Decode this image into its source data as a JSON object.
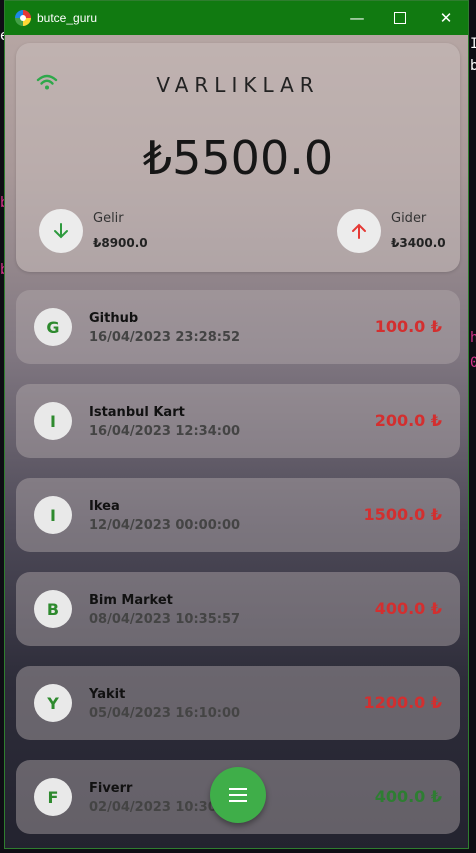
{
  "window": {
    "title": "butce_guru"
  },
  "summary": {
    "title": "VARLIKLAR",
    "balance": "₺5500.0",
    "income_label": "Gelir",
    "income_amount": "₺8900.0",
    "expense_label": "Gider",
    "expense_amount": "₺3400.0"
  },
  "transactions": [
    {
      "initial": "G",
      "name": "Github",
      "date": "16/04/2023 23:28:52",
      "amount": "100.0 ₺",
      "type": "expense"
    },
    {
      "initial": "I",
      "name": "Istanbul Kart",
      "date": "16/04/2023 12:34:00",
      "amount": "200.0 ₺",
      "type": "expense"
    },
    {
      "initial": "I",
      "name": "Ikea",
      "date": "12/04/2023 00:00:00",
      "amount": "1500.0 ₺",
      "type": "expense"
    },
    {
      "initial": "B",
      "name": "Bim Market",
      "date": "08/04/2023 10:35:57",
      "amount": "400.0 ₺",
      "type": "expense"
    },
    {
      "initial": "Y",
      "name": "Yakit",
      "date": "05/04/2023 16:10:00",
      "amount": "1200.0 ₺",
      "type": "expense"
    },
    {
      "initial": "F",
      "name": "Fiverr",
      "date": "02/04/2023 10:30:",
      "amount": "400.0 ₺",
      "type": "income"
    }
  ],
  "colors": {
    "income": "#2e7d32",
    "expense": "#d32f2f",
    "accent": "#3fae49",
    "titlebar": "#117a11"
  },
  "icons": [
    "wifi-icon",
    "arrow-down-icon",
    "arrow-up-icon",
    "menu-icon",
    "minimize-icon",
    "maximize-icon",
    "close-icon"
  ]
}
